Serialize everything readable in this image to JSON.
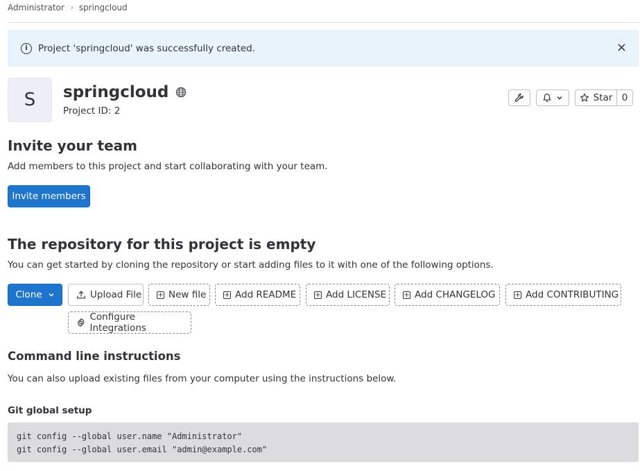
{
  "breadcrumb": {
    "items": [
      "Administrator",
      "springcloud"
    ],
    "separator": "›"
  },
  "alert": {
    "message": "Project 'springcloud' was successfully created.",
    "close_glyph": "×",
    "icon": "info-icon"
  },
  "project": {
    "avatar_letter": "S",
    "name": "springcloud",
    "id_label": "Project ID: 2",
    "visibility_icon": "globe-icon"
  },
  "header_actions": {
    "settings_icon": "wrench-icon",
    "notification_icon": "bell-icon",
    "star_label": "Star",
    "star_count": "0"
  },
  "invite": {
    "title": "Invite your team",
    "description": "Add members to this project and start collaborating with your team.",
    "button": "Invite members"
  },
  "repository": {
    "title": "The repository for this project is empty",
    "description": "You can get started by cloning the repository or start adding files to it with one of the following options.",
    "clone_label": "Clone",
    "actions": [
      "Upload File",
      "New file",
      "Add README",
      "Add LICENSE",
      "Add CHANGELOG",
      "Add CONTRIBUTING",
      "Configure Integrations"
    ]
  },
  "cli": {
    "title": "Command line instructions",
    "description": "You can also upload existing files from your computer using the instructions below.",
    "git_global_title": "Git global setup",
    "lines": [
      "git config --global user.name \"Administrator\"",
      "git config --global user.email \"admin@example.com\""
    ]
  },
  "colors": {
    "primary": "#1f75cb",
    "alert_bg": "#e9f3fc",
    "code_bg": "#dcdcde",
    "text": "#333238"
  }
}
